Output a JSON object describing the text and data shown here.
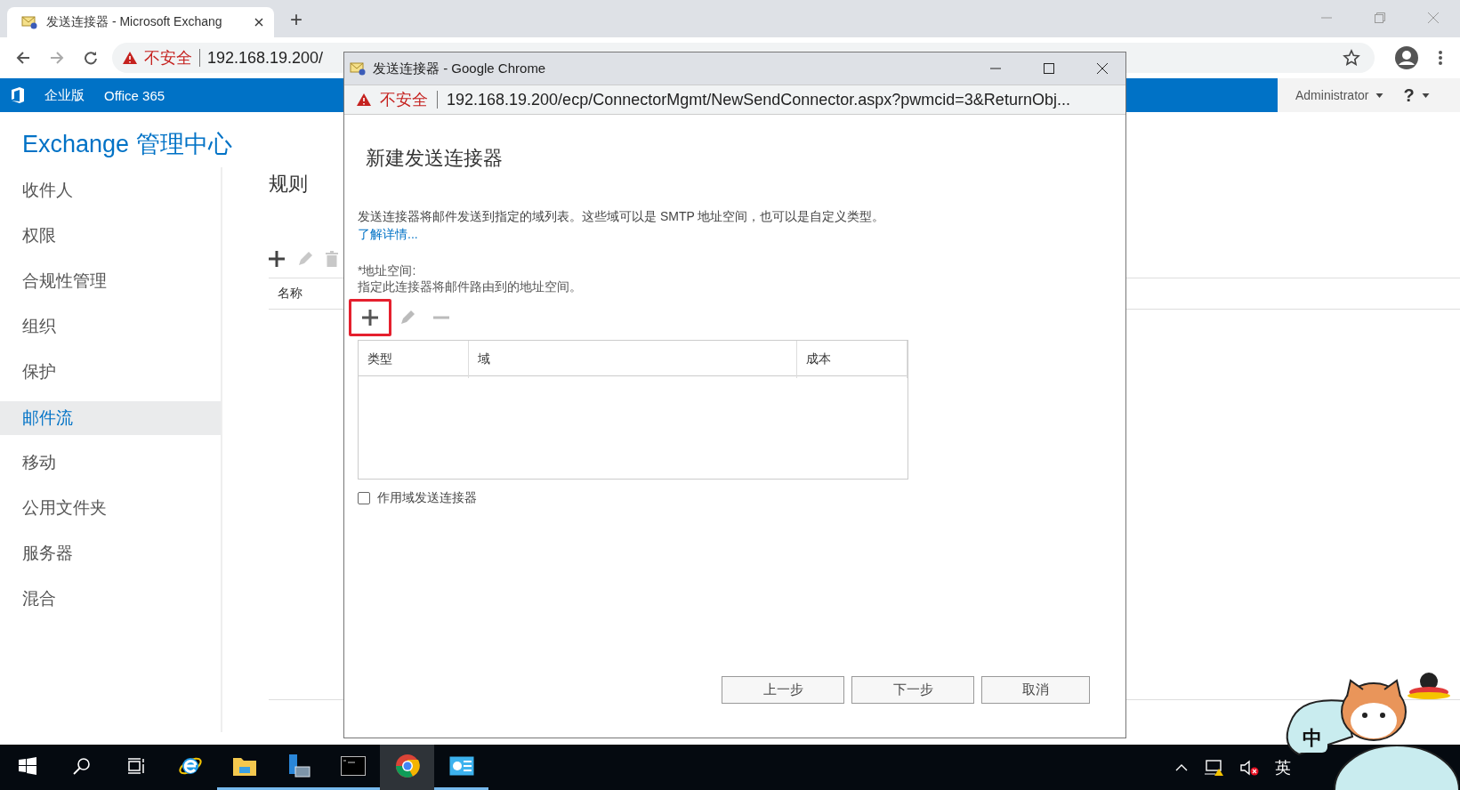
{
  "browser": {
    "tab_title": "发送连接器 - Microsoft Exchang",
    "new_tab": "+",
    "warning": "不安全",
    "url": "192.168.19.200/"
  },
  "app_bar": {
    "brand": "企业版",
    "office": "Office 365",
    "user": "Administrator",
    "help": "?"
  },
  "app_title": "Exchange 管理中心",
  "nav": [
    {
      "label": "收件人",
      "selected": false
    },
    {
      "label": "权限",
      "selected": false
    },
    {
      "label": "合规性管理",
      "selected": false
    },
    {
      "label": "组织",
      "selected": false
    },
    {
      "label": "保护",
      "selected": false
    },
    {
      "label": "邮件流",
      "selected": true
    },
    {
      "label": "移动",
      "selected": false
    },
    {
      "label": "公用文件夹",
      "selected": false
    },
    {
      "label": "服务器",
      "selected": false
    },
    {
      "label": "混合",
      "selected": false
    }
  ],
  "content": {
    "tab": "规则",
    "tools": [
      {
        "kind": "add",
        "disabled": false
      },
      {
        "kind": "edit",
        "disabled": true
      },
      {
        "kind": "delete",
        "disabled": true
      }
    ],
    "column": "名称"
  },
  "dialog": {
    "window_title": "发送连接器 - Google Chrome",
    "warning": "不安全",
    "url": "192.168.19.200/ecp/ConnectorMgmt/NewSendConnector.aspx?pwmcid=3&ReturnObj...",
    "heading": "新建发送连接器",
    "description": "发送连接器将邮件发送到指定的域列表。这些域可以是 SMTP 地址空间，也可以是自定义类型。",
    "learn_more": "了解详情...",
    "field_label": "*地址空间:",
    "field_hint": "指定此连接器将邮件路由到的地址空间。",
    "tools": [
      {
        "kind": "add",
        "disabled": false,
        "highlighted": true
      },
      {
        "kind": "edit",
        "disabled": true,
        "highlighted": false
      },
      {
        "kind": "remove",
        "disabled": true,
        "highlighted": false
      }
    ],
    "columns": [
      "类型",
      "域",
      "成本"
    ],
    "scoped": {
      "label": "作用域发送连接器",
      "checked": false
    },
    "buttons": [
      "上一步",
      "下一步",
      "取消"
    ]
  },
  "taskbar": {
    "apps": [
      {
        "kind": "start",
        "running": false,
        "selected": false
      },
      {
        "kind": "search",
        "running": false,
        "selected": false
      },
      {
        "kind": "taskview",
        "running": false,
        "selected": false
      },
      {
        "kind": "ie",
        "running": false,
        "selected": false
      },
      {
        "kind": "explorer",
        "running": true,
        "selected": false
      },
      {
        "kind": "server",
        "running": true,
        "selected": false
      },
      {
        "kind": "terminal",
        "running": true,
        "selected": false
      },
      {
        "kind": "chrome",
        "running": false,
        "selected": true
      },
      {
        "kind": "panel",
        "running": true,
        "selected": false
      }
    ],
    "ime": "英"
  },
  "mascot": {
    "label": "中"
  }
}
